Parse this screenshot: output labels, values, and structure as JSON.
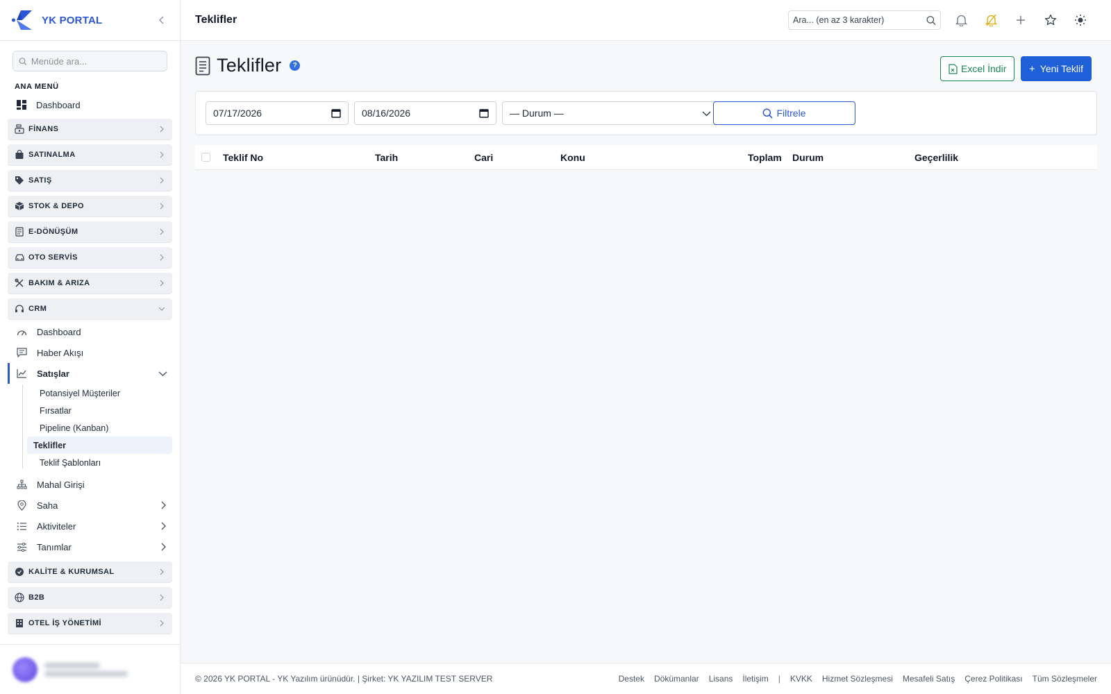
{
  "brand": {
    "name": "YK PORTAL"
  },
  "sidebar": {
    "search_placeholder": "Menüde ara...",
    "section_title": "ANA MENÜ",
    "dashboard": "Dashboard",
    "groups": [
      {
        "label": "FİNANS",
        "icon": "cash-register-icon"
      },
      {
        "label": "SATINALMA",
        "icon": "shopping-bag-icon"
      },
      {
        "label": "SATIŞ",
        "icon": "tag-icon"
      },
      {
        "label": "STOK & DEPO",
        "icon": "box-icon"
      },
      {
        "label": "E-DÖNÜŞÜM",
        "icon": "document-icon"
      },
      {
        "label": "OTO SERVİS",
        "icon": "car-icon"
      },
      {
        "label": "BAKIM & ARIZA",
        "icon": "tools-icon"
      },
      {
        "label": "CRM",
        "icon": "headset-icon"
      }
    ],
    "crm_items": {
      "dashboard": "Dashboard",
      "news": "Haber Akışı",
      "sales": "Satışlar",
      "sales_leaves": [
        "Potansiyel Müşteriler",
        "Fırsatlar",
        "Pipeline (Kanban)",
        "Teklifler",
        "Teklif Şablonları"
      ],
      "mahal": "Mahal Girişi",
      "saha": "Saha",
      "activities": "Aktiviteler",
      "definitions": "Tanımlar"
    },
    "bottom_groups": [
      {
        "label": "KALİTE & KURUMSAL",
        "icon": "badge-check-icon"
      },
      {
        "label": "B2B",
        "icon": "globe-icon"
      },
      {
        "label": "OTEL İŞ YÖNETİMİ",
        "icon": "building-icon"
      }
    ]
  },
  "topbar": {
    "title": "Teklifler",
    "search_placeholder": "Ara... (en az 3 karakter)"
  },
  "page": {
    "title": "Teklifler",
    "excel_label": "Excel İndir",
    "new_label": "Yeni Teklif",
    "filters": {
      "date_from": "07/17/2026",
      "date_to": "08/16/2026",
      "status": "— Durum —",
      "filter_label": "Filtrele"
    },
    "columns": [
      "Teklif No",
      "Tarih",
      "Cari",
      "Konu",
      "Toplam",
      "Durum",
      "Geçerlilik"
    ]
  },
  "footer": {
    "copyright": "© 2026 YK PORTAL - YK Yazılım ürünüdür. | Şirket: YK YAZILIM TEST SERVER",
    "links_left": [
      "Destek",
      "Dökümanlar",
      "Lisans",
      "İletişim"
    ],
    "links_right": [
      "KVKK",
      "Hizmet Sözleşmesi",
      "Mesafeli Satış",
      "Çerez Politikası",
      "Tüm Sözleşmeler"
    ]
  },
  "colors": {
    "accent": "#1f5fd8",
    "excel": "#198754",
    "help": "#2f6fe0",
    "bell_alert": "#e0a800"
  }
}
